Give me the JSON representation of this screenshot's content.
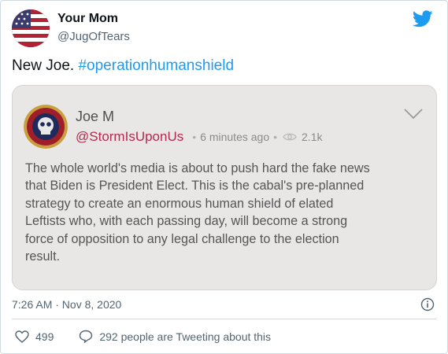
{
  "author": {
    "name": "Your Mom",
    "handle": "@JugOfTears"
  },
  "tweet": {
    "text": "New Joe. ",
    "hashtag": "#operationhumanshield"
  },
  "quote": {
    "name": "Joe M",
    "handle": "@StormIsUponUs",
    "time": "6 minutes ago",
    "views": "2.1k",
    "lines": [
      "The whole world's media is about to push hard the fake news",
      "that Biden is President Elect. This is the cabal's pre-planned",
      "strategy to create an enormous human shield of elated",
      "Leftists who, with each passing day, will become a strong",
      "force of opposition to any legal challenge to the election",
      "result."
    ]
  },
  "timestamp": "7:26 AM · Nov 8, 2020",
  "likes": "499",
  "replies_text": "292 people are Tweeting about this",
  "colors": {
    "twitter_blue": "#1d9bf0",
    "quote_handle": "#b5294e"
  },
  "icons": [
    "twitter-bird-icon",
    "chevron-down-icon",
    "eye-icon",
    "info-icon",
    "heart-icon",
    "comment-icon"
  ]
}
